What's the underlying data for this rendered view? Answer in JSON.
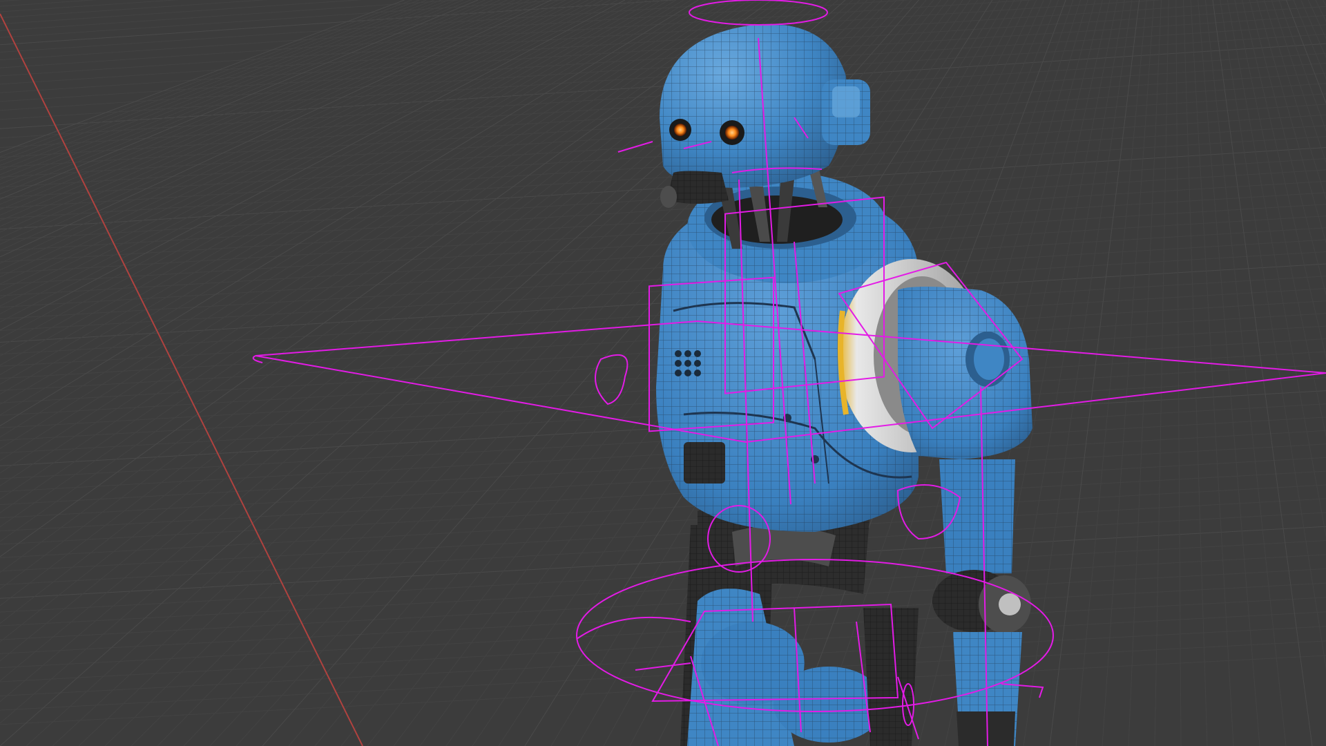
{
  "scene": {
    "description_free": true,
    "colors": {
      "background": "#3c3c3c",
      "grid": "#4a4a4a",
      "grid_fine": "#434343",
      "x_axis": "#b0423f",
      "body": "#3f86c4",
      "body_shade": "#2c5f8f",
      "body_highlight": "#6aa9de",
      "mechanism": "#2b2b2b",
      "mechanism_light": "#4d4d4d",
      "joint_ring": "#d9d9d9",
      "joint_accent": "#e8b42a",
      "eye": "#ff8a1a",
      "rig": "#e31be6",
      "wire": "#1e2e40"
    },
    "icons": {
      "eye_left": "eye-icon",
      "eye_right": "eye-icon"
    }
  }
}
